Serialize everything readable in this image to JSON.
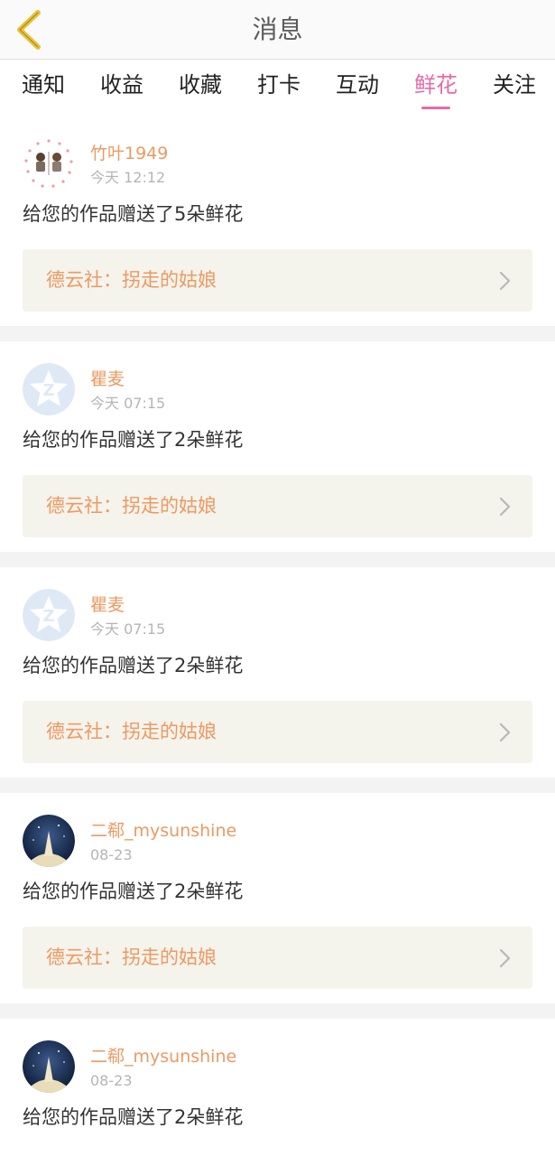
{
  "header": {
    "title": "消息"
  },
  "tabs": [
    {
      "label": "通知",
      "active": false
    },
    {
      "label": "收益",
      "active": false
    },
    {
      "label": "收藏",
      "active": false
    },
    {
      "label": "打卡",
      "active": false
    },
    {
      "label": "互动",
      "active": false
    },
    {
      "label": "鲜花",
      "active": true
    },
    {
      "label": "关注",
      "active": false
    }
  ],
  "colors": {
    "accent": "#e86aa9",
    "username": "#ec9a62",
    "link_bg": "#f4f3ec"
  },
  "items": [
    {
      "username": "竹叶1949",
      "time": "今天 12:12",
      "message": "给您的作品赠送了5朵鲜花",
      "work": "德云社：拐走的姑娘",
      "avatar": "couple-avatar"
    },
    {
      "username": "瞿麦",
      "time": "今天 07:15",
      "message": "给您的作品赠送了2朵鲜花",
      "work": "德云社：拐走的姑娘",
      "avatar": "qq-default-avatar"
    },
    {
      "username": "瞿麦",
      "time": "今天 07:15",
      "message": "给您的作品赠送了2朵鲜花",
      "work": "德云社：拐走的姑娘",
      "avatar": "qq-default-avatar"
    },
    {
      "username": "二郗_mysunshine",
      "time": "08-23",
      "message": "给您的作品赠送了2朵鲜花",
      "work": "德云社：拐走的姑娘",
      "avatar": "night-sky-avatar"
    },
    {
      "username": "二郗_mysunshine",
      "time": "08-23",
      "message": "给您的作品赠送了2朵鲜花",
      "work": "",
      "avatar": "night-sky-avatar"
    }
  ]
}
